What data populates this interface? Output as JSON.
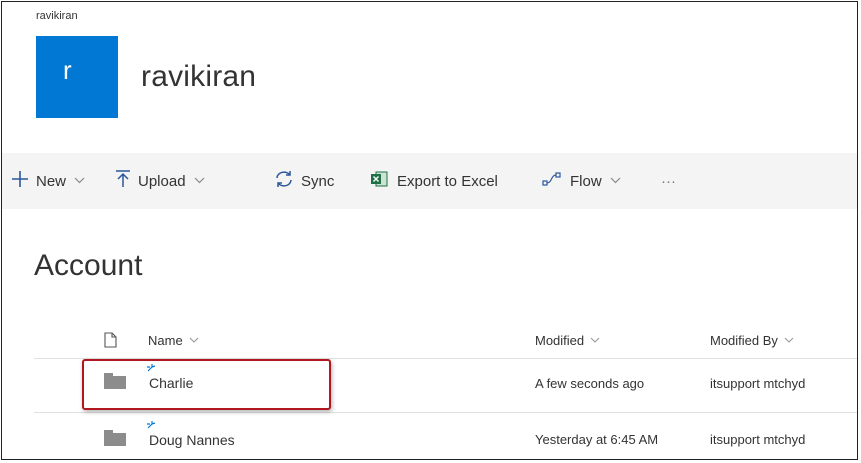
{
  "site": {
    "breadcrumb": "ravikiran",
    "logo_letter": "r",
    "title": "ravikiran"
  },
  "toolbar": {
    "new_label": "New",
    "upload_label": "Upload",
    "sync_label": "Sync",
    "export_label": "Export to Excel",
    "flow_label": "Flow",
    "more_label": "···"
  },
  "library": {
    "title": "Account"
  },
  "columns": {
    "name": "Name",
    "modified": "Modified",
    "modified_by": "Modified By"
  },
  "rows": [
    {
      "name": "Charlie",
      "modified": "A few seconds ago",
      "modified_by": "itsupport mtchyd"
    },
    {
      "name": "Doug Nannes",
      "modified": "Yesterday at 6:45 AM",
      "modified_by": "itsupport mtchyd"
    }
  ],
  "colors": {
    "accent": "#0078d4",
    "highlight_border": "#b0171f"
  }
}
